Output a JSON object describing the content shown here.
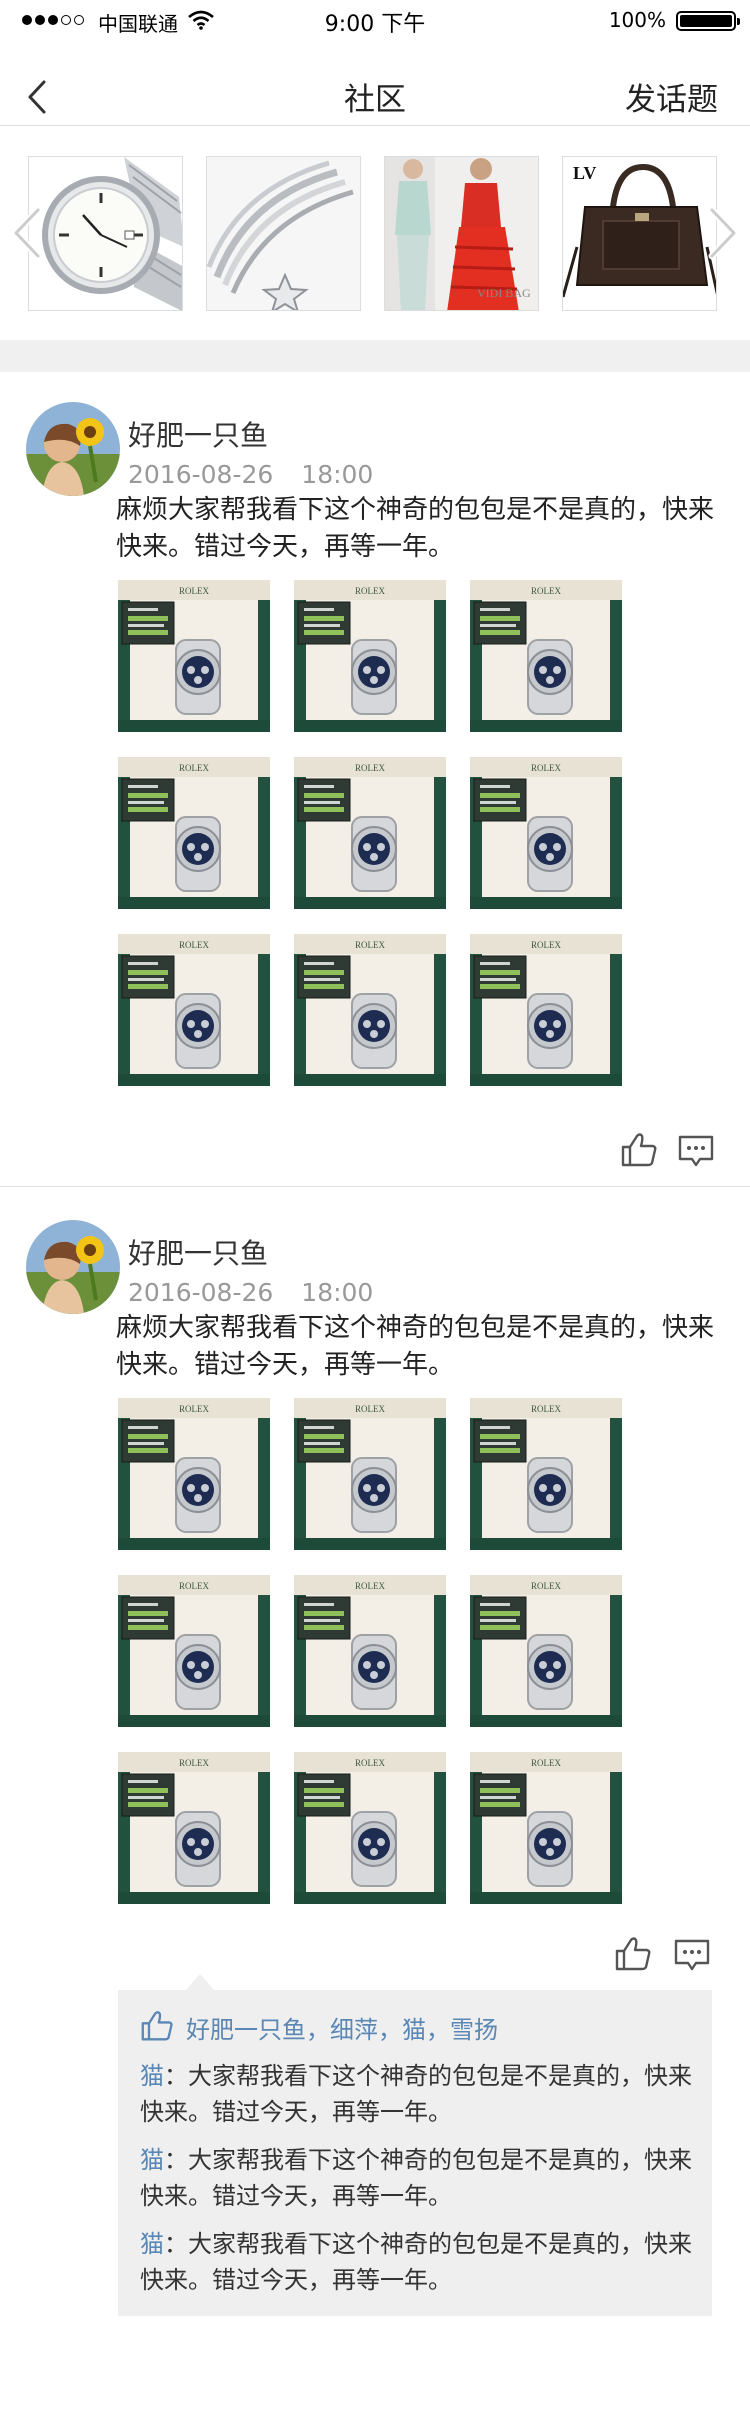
{
  "status_bar": {
    "carrier": "中国联通",
    "time": "9:00 下午",
    "battery": "100%",
    "battery_level": 1.0,
    "signal_bars_filled": 3,
    "signal_bars_total": 5
  },
  "nav": {
    "title": "社区",
    "action_label": "发话题",
    "back_icon": "chevron-left-icon"
  },
  "banner": {
    "items": [
      "watch-photo",
      "bracelet-photo",
      "fashion-photo",
      "handbag-photo"
    ],
    "prev_icon": "chevron-left-icon",
    "next_icon": "chevron-right-icon"
  },
  "posts": [
    {
      "username": "好肥一只鱼",
      "date": "2016-08-26",
      "time": "18:00",
      "text": "麻烦大家帮我看下这个神奇的包包是不是真的，快来快来。错过今天，再等一年。",
      "photo_count": 9
    },
    {
      "username": "好肥一只鱼",
      "date": "2016-08-26",
      "time": "18:00",
      "text": "麻烦大家帮我看下这个神奇的包包是不是真的，快来快来。错过今天，再等一年。",
      "photo_count": 9,
      "likes": "好肥一只鱼，细萍，猫，雪扬",
      "comments": [
        {
          "name": "猫",
          "text": "：大家帮我看下这个神奇的包包是不是真的，快来快来。错过今天，再等一年。"
        },
        {
          "name": "猫",
          "text": "：大家帮我看下这个神奇的包包是不是真的，快来快来。错过今天，再等一年。"
        },
        {
          "name": "猫",
          "text": "：大家帮我看下这个神奇的包包是不是真的，快来快来。错过今天，再等一年。"
        }
      ]
    }
  ],
  "photo_label": "ROLEX",
  "colors": {
    "link_blue": "#5a87b3",
    "meta_gray": "#999999",
    "comment_bg": "#efefef",
    "section_gap": "#f0f0f0",
    "icon_gray": "#555555"
  }
}
